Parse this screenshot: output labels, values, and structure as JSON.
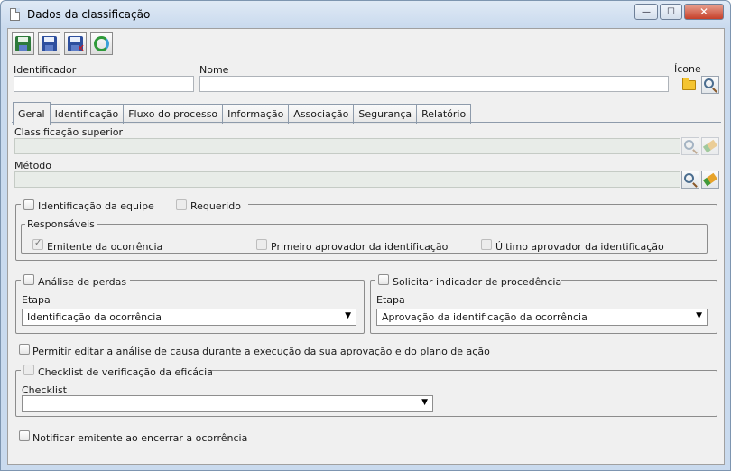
{
  "window": {
    "title": "Dados da classificação",
    "minimize": "—",
    "maximize": "☐",
    "close": "✕"
  },
  "toolbar": {
    "save": "save-icon",
    "save_exit": "save-exit-icon",
    "save_new": "save-discard-icon",
    "refresh": "refresh-icon"
  },
  "header": {
    "identificador_label": "Identificador",
    "identificador_value": "",
    "nome_label": "Nome",
    "nome_value": "",
    "icone_label": "Ícone"
  },
  "tabs": [
    "Geral",
    "Identificação",
    "Fluxo do processo",
    "Informação",
    "Associação",
    "Segurança",
    "Relatório"
  ],
  "geral": {
    "classificacao_superior_label": "Classificação superior",
    "metodo_label": "Método",
    "identificacao_equipe": "Identificação da equipe",
    "requerido": "Requerido",
    "responsaveis_legend": "Responsáveis",
    "emitente": "Emitente da ocorrência",
    "primeiro_aprovador": "Primeiro aprovador da identificação",
    "ultimo_aprovador": "Último aprovador da identificação",
    "analise_perdas": "Análise de perdas",
    "etapa_label": "Etapa",
    "etapa_perdas_value": "Identificação da ocorrência",
    "solicitar_indicador": "Solicitar indicador de procedência",
    "etapa2_label": "Etapa",
    "etapa_indicador_value": "Aprovação da identificação da ocorrência",
    "permitir_editar": "Permitir editar a análise de causa durante a execução da sua aprovação e do plano de ação",
    "checklist_legend": "Checklist de verificação da eficácia",
    "checklist_label": "Checklist",
    "checklist_value": "",
    "notificar": "Notificar emitente ao encerrar a ocorrência"
  }
}
